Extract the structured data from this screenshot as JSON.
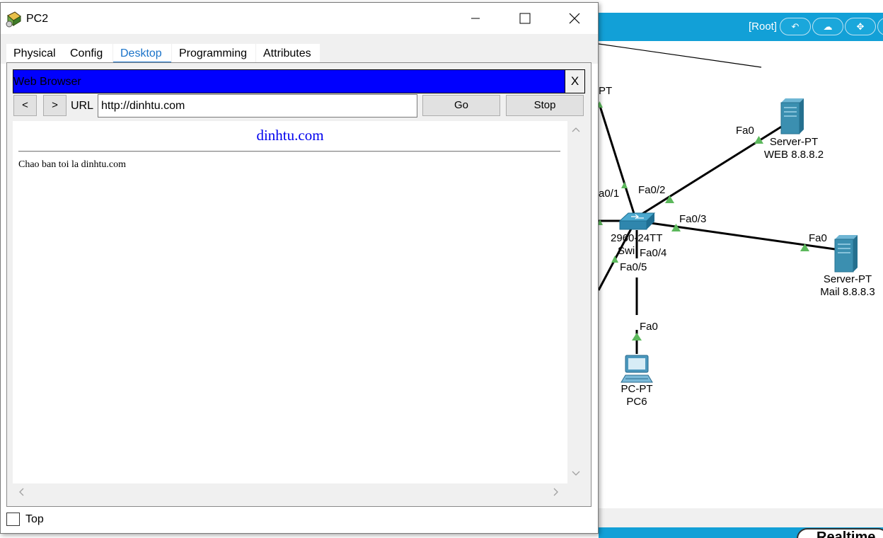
{
  "window": {
    "title": "PC2",
    "icon": "pc-config-icon"
  },
  "tabs": [
    {
      "label": "Physical",
      "active": false
    },
    {
      "label": "Config",
      "active": false
    },
    {
      "label": "Desktop",
      "active": true
    },
    {
      "label": "Programming",
      "active": false
    },
    {
      "label": "Attributes",
      "active": false
    }
  ],
  "browser": {
    "title": "Web Browser",
    "close_label": "X",
    "back_label": "<",
    "forward_label": ">",
    "url_label": "URL",
    "url_value": "http://dinhtu.com",
    "go_label": "Go",
    "stop_label": "Stop",
    "page": {
      "heading": "dinhtu.com",
      "body": "Chao ban toi la dinhtu.com"
    }
  },
  "footer": {
    "top_checkbox_checked": false,
    "top_label": "Top"
  },
  "topology": {
    "root_label": "[Root]",
    "labels": {
      "pt_partial": "PT",
      "fa0_web": "Fa0",
      "server_web_type": "Server-PT",
      "server_web_name": "WEB 8.8.8.2",
      "fa0_1": "a0/1",
      "fa0_2": "Fa0/2",
      "fa0_3": "Fa0/3",
      "switch_model": "2960-24TT",
      "switch_name": "Swi",
      "fa0_4": "Fa0/4",
      "fa0_5": "Fa0/5",
      "fa0_mail": "Fa0",
      "server_mail_type": "Server-PT",
      "server_mail_name": "Mail 8.8.8.3",
      "fa0_pc6": "Fa0",
      "pc6_type": "PC-PT",
      "pc6_name": "PC6",
      "realtime_label": "Realtime"
    }
  },
  "colors": {
    "toolbar_blue": "#12a0d7",
    "browser_title_bar": "#0000ff",
    "active_tab": "#1a73c9",
    "link_port": "#5cb85c",
    "server": "#3b8fb0"
  }
}
